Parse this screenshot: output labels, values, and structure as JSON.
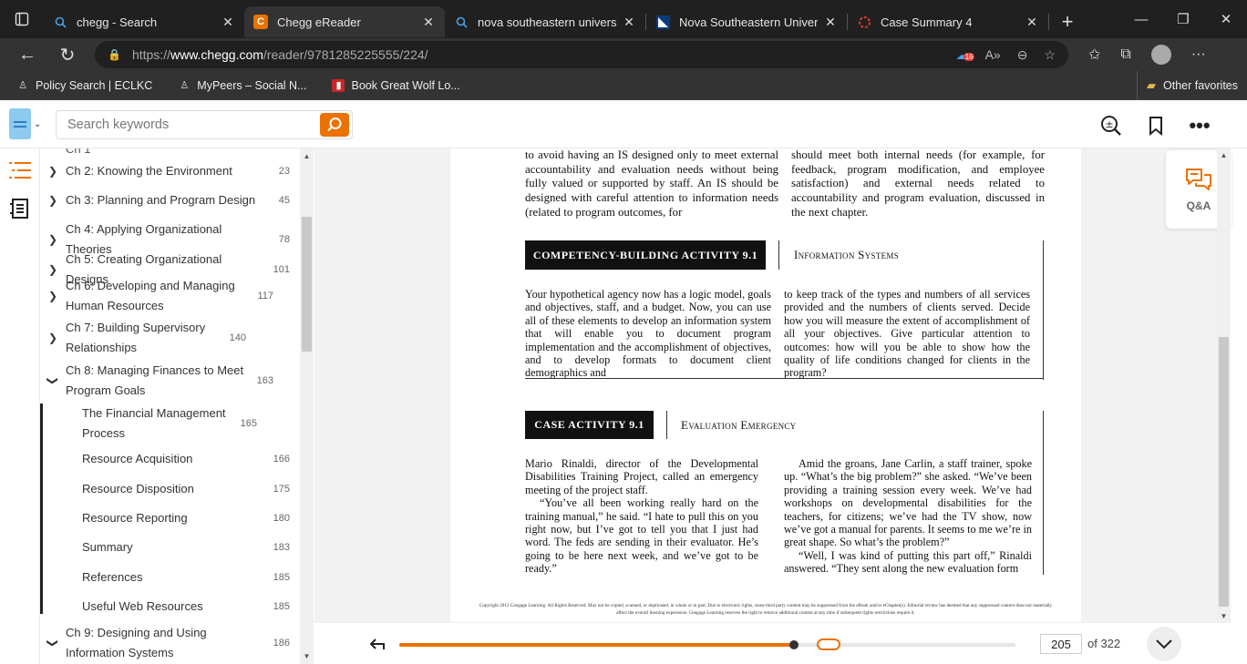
{
  "browser": {
    "tabs": [
      {
        "title": "chegg - Search",
        "favicon": "search-icon",
        "active": false
      },
      {
        "title": "Chegg eReader",
        "favicon": "chegg-logo",
        "active": true
      },
      {
        "title": "nova southeastern university",
        "favicon": "search-icon",
        "active": false
      },
      {
        "title": "Nova Southeastern University",
        "favicon": "nsu-logo",
        "active": false
      },
      {
        "title": "Case Summary 4",
        "favicon": "loading-icon",
        "active": false
      }
    ],
    "url_prefix": "https://",
    "url_host": "www.chegg.com",
    "url_path": "/reader/9781285225555/224/",
    "extension_badge": "16",
    "favorites": [
      {
        "label": "Policy Search | ECLKC"
      },
      {
        "label": "MyPeers – Social N..."
      },
      {
        "label": "Book Great Wolf Lo..."
      }
    ],
    "other_favorites": "Other favorites"
  },
  "reader": {
    "search_placeholder": "Search keywords",
    "qa_label": "Q&A",
    "toc": [
      {
        "label": "Ch 2: Knowing the Environment",
        "page": "23",
        "expanded": false
      },
      {
        "label": "Ch 3: Planning and Program Design",
        "page": "45",
        "expanded": false
      },
      {
        "label": "Ch 4: Applying Organizational Theories",
        "page": "78",
        "expanded": false
      },
      {
        "label": "Ch 5: Creating Organizational Designs",
        "page": "101",
        "expanded": false
      },
      {
        "label": "Ch 6: Developing and Managing Human Resources",
        "page": "117",
        "expanded": false
      },
      {
        "label": "Ch 7: Building Supervisory Relationships",
        "page": "140",
        "expanded": false
      },
      {
        "label": "Ch 8: Managing Finances to Meet Program Goals",
        "page": "163",
        "expanded": true
      },
      {
        "label": "The Financial Management Process",
        "page": "165",
        "sub": true
      },
      {
        "label": "Resource Acquisition",
        "page": "166",
        "sub": true
      },
      {
        "label": "Resource Disposition",
        "page": "175",
        "sub": true
      },
      {
        "label": "Resource Reporting",
        "page": "180",
        "sub": true
      },
      {
        "label": "Summary",
        "page": "183",
        "sub": true
      },
      {
        "label": "References",
        "page": "185",
        "sub": true
      },
      {
        "label": "Useful Web Resources",
        "page": "185",
        "sub": true
      },
      {
        "label": "Ch 9: Designing and Using Information Systems",
        "page": "186",
        "expanded": true
      }
    ],
    "current_page": "205",
    "total_pages": "of 322",
    "progress": 0.64
  },
  "book": {
    "top_left": "to avoid having an IS designed only to meet external accountability and evaluation needs without being fully valued or supported by staff. An IS should be designed with careful attention to information needs (related to program outcomes, for",
    "top_right": "should meet both internal needs (for example, for feedback, program modification, and employee satisfaction) and external needs related to accountability and program evaluation, discussed in the next chapter.",
    "box1_title": "COMPETENCY-BUILDING ACTIVITY 9.1",
    "box1_subtitle": "Information Systems",
    "box1_left": "Your hypothetical agency now has a logic model, goals and objectives, staff, and a budget. Now, you can use all of these elements to develop an information system that will enable you to document program implementation and the accomplishment of objectives, and to develop formats to document client demographics and",
    "box1_right": "to keep track of the types and numbers of all services provided and the numbers of clients served. Decide how you will measure the extent of accomplishment of all your objectives. Give particular attention to outcomes: how will you be able to show how the quality of life conditions changed for clients in the program?",
    "box2_title": "CASE ACTIVITY 9.1",
    "box2_subtitle": "Evaluation Emergency",
    "box2_left": "Mario Rinaldi, director of the Developmental Disabilities Training Project, called an emergency meeting of the project staff.",
    "box2_left_p2": "“You’ve all been working really hard on the training manual,” he said. “I hate to pull this on you right now, but I’ve got to tell you that I just had word. The feds are sending in their evaluator. He’s going to be here next week, and we’ve got to be ready.”",
    "box2_right": "Amid the groans, Jane Carlin, a staff trainer, spoke up. “What’s the big problem?” she asked. “We’ve been providing a training session every week. We’ve had workshops on developmental disabilities for the teachers, for citizens; we’ve had the TV show, now we’ve got a manual for parents. It seems to me we’re in great shape. So what’s the problem?”",
    "box2_right_p2": "“Well, I was kind of putting this part off,” Rinaldi answered. “They sent along the new evaluation form",
    "copyright": "Copyright 2012 Cengage Learning. All Rights Reserved. May not be copied, scanned, or duplicated, in whole or in part. Due to electronic rights, some third party content may be suppressed from the eBook and/or eChapter(s). Editorial review has deemed that any suppressed content does not materially affect the overall learning experience. Cengage Learning reserves the right to remove additional content at any time if subsequent rights restrictions require it."
  },
  "colors": {
    "accent": "#eb7100",
    "chrome": "#202020",
    "chrome_bar": "#333333"
  }
}
